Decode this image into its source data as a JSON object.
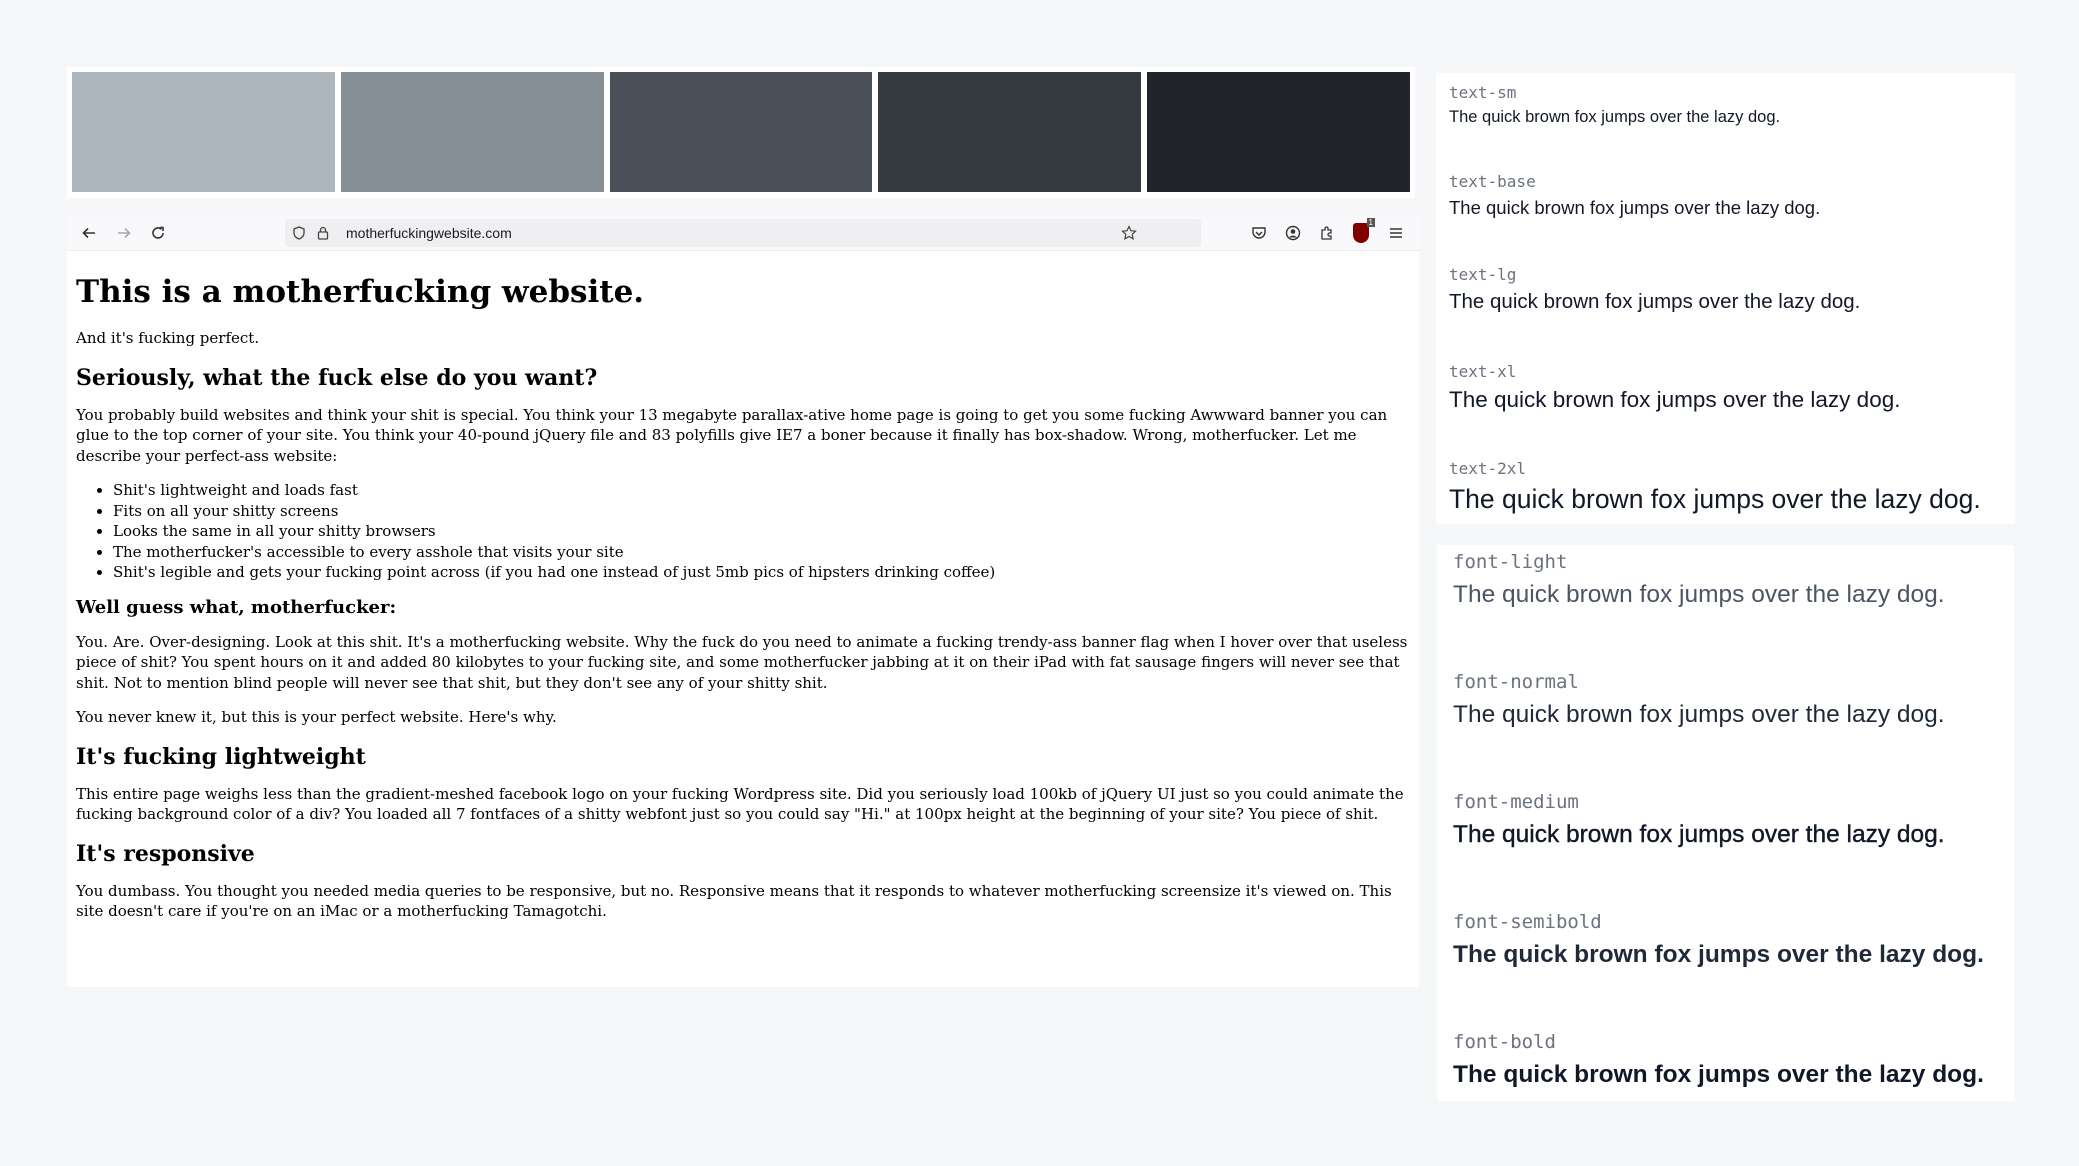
{
  "swatch_colors": [
    "#adb5bd",
    "#868e96",
    "#495057",
    "#343a40",
    "#212529"
  ],
  "browser": {
    "url": "motherfuckingwebsite.com",
    "extension_badge": "1"
  },
  "page": {
    "h1": "This is a motherfucking website.",
    "tagline": "And it's fucking perfect.",
    "h2_1": "Seriously, what the fuck else do you want?",
    "p1": "You probably build websites and think your shit is special. You think your 13 megabyte parallax-ative home page is going to get you some fucking Awwward banner you can glue to the top corner of your site. You think your 40-pound jQuery file and 83 polyfills give IE7 a boner because it finally has box-shadow. Wrong, motherfucker. Let me describe your perfect-ass website:",
    "list": [
      "Shit's lightweight and loads fast",
      "Fits on all your shitty screens",
      "Looks the same in all your shitty browsers",
      "The motherfucker's accessible to every asshole that visits your site",
      "Shit's legible and gets your fucking point across (if you had one instead of just 5mb pics of hipsters drinking coffee)"
    ],
    "h3_1": "Well guess what, motherfucker:",
    "p2": "You. Are. Over-designing. Look at this shit. It's a motherfucking website. Why the fuck do you need to animate a fucking trendy-ass banner flag when I hover over that useless piece of shit? You spent hours on it and added 80 kilobytes to your fucking site, and some motherfucker jabbing at it on their iPad with fat sausage fingers will never see that shit. Not to mention blind people will never see that shit, but they don't see any of your shitty shit.",
    "p3": "You never knew it, but this is your perfect website. Here's why.",
    "h2_2": "It's fucking lightweight",
    "p4": "This entire page weighs less than the gradient-meshed facebook logo on your fucking Wordpress site. Did you seriously load 100kb of jQuery UI just so you could animate the fucking background color of a div? You loaded all 7 fontfaces of a shitty webfont just so you could say \"Hi.\" at 100px height at the beginning of your site? You piece of shit.",
    "h2_3": "It's responsive",
    "p5": "You dumbass. You thought you needed media queries to be responsive, but no. Responsive means that it responds to whatever motherfucking screensize it's viewed on. This site doesn't care if you're on an iMac or a motherfucking Tamagotchi."
  },
  "font_sizes": [
    {
      "label": "text-sm",
      "text": "The quick brown fox jumps over the lazy dog."
    },
    {
      "label": "text-base",
      "text": "The quick brown fox jumps over the lazy dog."
    },
    {
      "label": "text-lg",
      "text": "The quick brown fox jumps over the lazy dog."
    },
    {
      "label": "text-xl",
      "text": "The quick brown fox jumps over the lazy dog."
    },
    {
      "label": "text-2xl",
      "text": "The quick brown fox jumps over the lazy dog."
    }
  ],
  "font_weights": [
    {
      "label": "font-light",
      "text": "The quick brown fox jumps over the lazy dog."
    },
    {
      "label": "font-normal",
      "text": "The quick brown fox jumps over the lazy dog."
    },
    {
      "label": "font-medium",
      "text": "The quick brown fox jumps over the lazy dog."
    },
    {
      "label": "font-semibold",
      "text": "The quick brown fox jumps over the lazy dog."
    },
    {
      "label": "font-bold",
      "text": "The quick brown fox jumps over the lazy dog."
    }
  ]
}
